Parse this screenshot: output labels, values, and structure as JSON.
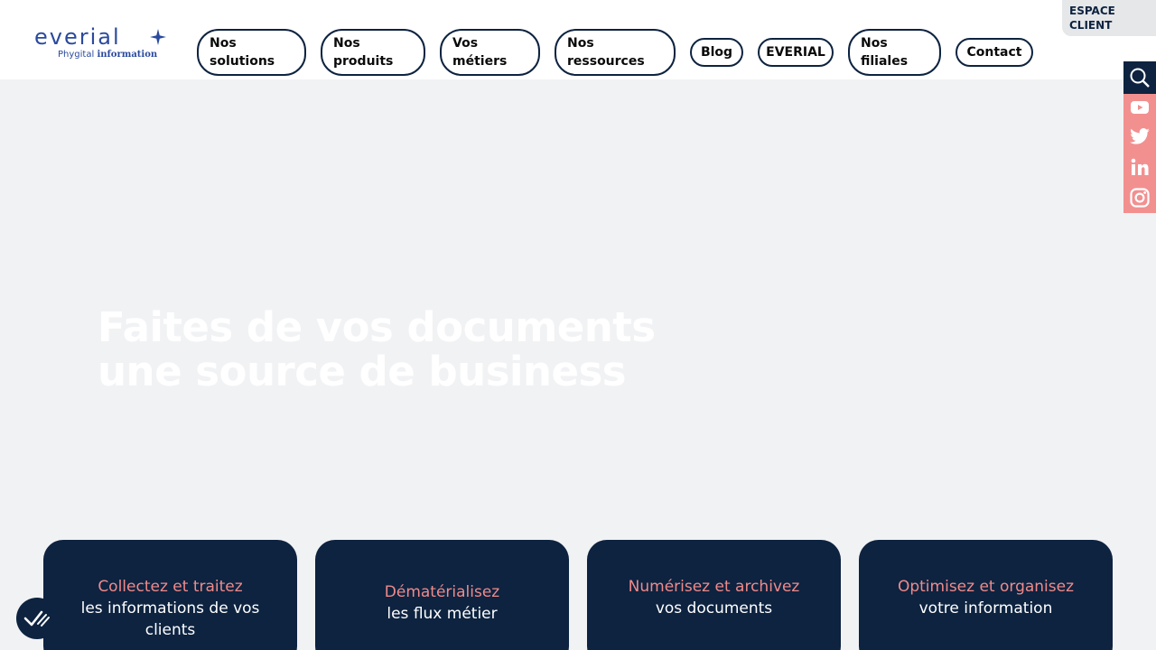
{
  "brand": {
    "name": "everial",
    "tagline_plain": "Phygital",
    "tagline_bold": "information"
  },
  "nav": {
    "solutions": [
      "Nos",
      "solutions"
    ],
    "produits": [
      "Nos",
      "produits"
    ],
    "metiers": [
      "Vos",
      "métiers"
    ],
    "ressources": [
      "Nos",
      "ressources"
    ],
    "blog": "Blog",
    "everial": "EVERIAL",
    "filiales": [
      "Nos",
      "filiales"
    ],
    "contact": "Contact"
  },
  "espace_client": [
    "ESPACE",
    "CLIENT"
  ],
  "social": {
    "icons": [
      "search-icon",
      "youtube-icon",
      "twitter-icon",
      "linkedin-icon",
      "instagram-icon"
    ],
    "colors": {
      "search_bg": "#0d2340",
      "social_bg": "#f29090"
    }
  },
  "hero": {
    "line1": "Faites de vos documents",
    "line2": "une source de business"
  },
  "cards": [
    {
      "highlight": "Collectez et traitez",
      "text1": "les informations de vos",
      "text2": "clients"
    },
    {
      "highlight": "Dématérialisez",
      "text1": "les flux métier",
      "text2": ""
    },
    {
      "highlight": "Numérisez et archivez",
      "text1": "vos documents",
      "text2": ""
    },
    {
      "highlight": "Optimisez et organisez",
      "text1": "votre information",
      "text2": ""
    }
  ],
  "colors": {
    "navy": "#0d2340",
    "pink": "#f08a8a",
    "brand_blue": "#2a4a9e",
    "page_bg": "#f1f2f4"
  }
}
